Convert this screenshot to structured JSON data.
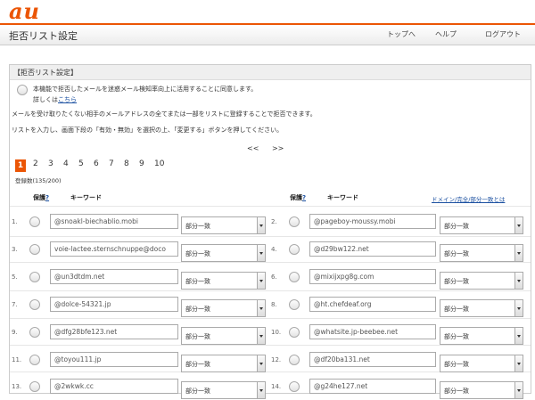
{
  "brand": "au",
  "header": {
    "title": "拒否リスト設定",
    "nav": [
      "トップへ",
      "ヘルプ",
      "ログアウト"
    ]
  },
  "panel": {
    "heading": "【拒否リスト設定】",
    "consent_text": "本機能で拒否したメールを迷惑メール検知率向上に活用することに同意します。",
    "details_prefix": "詳しくは",
    "details_link": "こちら",
    "desc1": "メールを受け取りたくない相手のメールアドレスの全てまたは一部をリストに登録することで拒否できます。",
    "desc2": "リストを入力し、画面下段の「有効・無効」を選択の上、「変更する」ボタンを押してください。"
  },
  "pager": {
    "prev": "<<",
    "next": ">>",
    "pages": [
      "1",
      "2",
      "3",
      "4",
      "5",
      "6",
      "7",
      "8",
      "9",
      "10"
    ],
    "current": "1",
    "count_label": "登録数(135/200)"
  },
  "columns": {
    "protect": "保護",
    "help": "?",
    "keyword": "キーワード",
    "match_help": "ドメイン/完全/部分一致とは"
  },
  "entries": [
    {
      "num": "1.",
      "keyword": "@snoakl-biechablio.mobi",
      "match": "部分一致"
    },
    {
      "num": "2.",
      "keyword": "@pageboy-moussy.mobi",
      "match": "部分一致"
    },
    {
      "num": "3.",
      "keyword": "voie-lactee.sternschnuppe@doco",
      "match": "部分一致"
    },
    {
      "num": "4.",
      "keyword": "@d29bw122.net",
      "match": "部分一致"
    },
    {
      "num": "5.",
      "keyword": "@un3dtdm.net",
      "match": "部分一致"
    },
    {
      "num": "6.",
      "keyword": "@mixijxpg8g.com",
      "match": "部分一致"
    },
    {
      "num": "7.",
      "keyword": "@dolce-54321.jp",
      "match": "部分一致"
    },
    {
      "num": "8.",
      "keyword": "@ht.chefdeaf.org",
      "match": "部分一致"
    },
    {
      "num": "9.",
      "keyword": "@dfg28bfe123.net",
      "match": "部分一致"
    },
    {
      "num": "10.",
      "keyword": "@whatsite.jp-beebee.net",
      "match": "部分一致"
    },
    {
      "num": "11.",
      "keyword": "@toyou111.jp",
      "match": "部分一致"
    },
    {
      "num": "12.",
      "keyword": "@df20ba131.net",
      "match": "部分一致"
    },
    {
      "num": "13.",
      "keyword": "@2wkwk.cc",
      "match": "部分一致"
    },
    {
      "num": "14.",
      "keyword": "@g24he127.net",
      "match": "部分一致"
    }
  ],
  "colors": {
    "accent": "#eb5505",
    "link": "#1a4fa0"
  }
}
